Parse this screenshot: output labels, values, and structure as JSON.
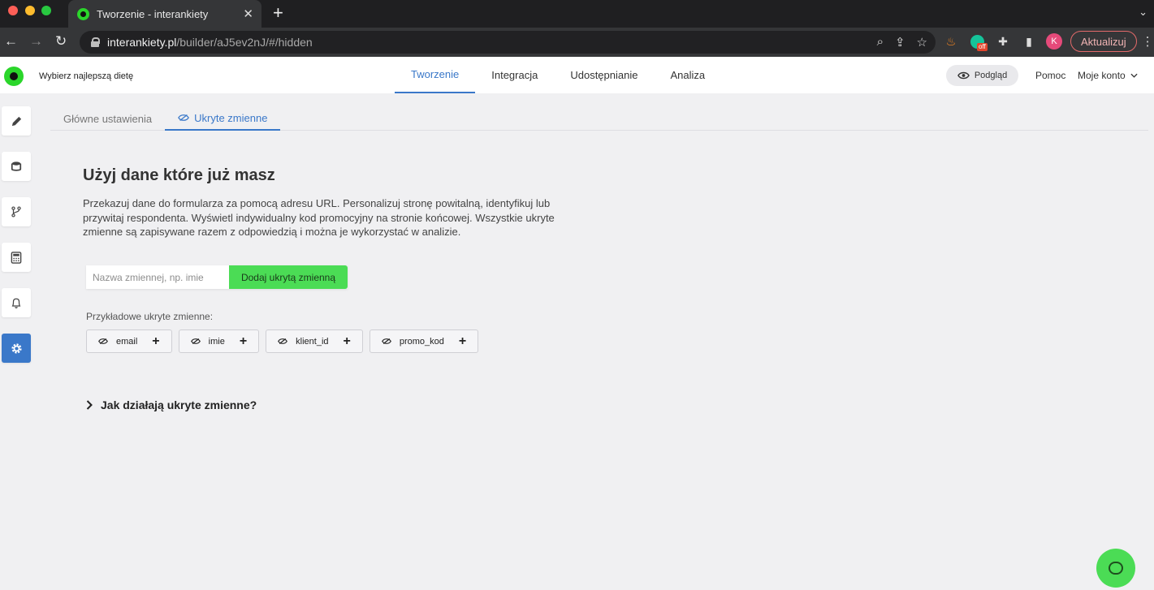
{
  "browser": {
    "tab_title": "Tworzenie - interankiety",
    "url_host": "interankiety.pl",
    "url_path": "/builder/aJ5ev2nJ/#/hidden",
    "extension_badge": "off",
    "avatar_letter": "K",
    "update_label": "Aktualizuj"
  },
  "header": {
    "survey_name": "Wybierz najlepszą dietę",
    "nav": [
      {
        "label": "Tworzenie",
        "active": true
      },
      {
        "label": "Integracja"
      },
      {
        "label": "Udostępnianie"
      },
      {
        "label": "Analiza"
      }
    ],
    "preview_label": "Podgląd",
    "help_label": "Pomoc",
    "account_label": "Moje konto"
  },
  "sidebar": {
    "items": [
      {
        "icon": "pencil-icon"
      },
      {
        "icon": "database-icon"
      },
      {
        "icon": "branch-icon"
      },
      {
        "icon": "calculator-icon"
      },
      {
        "icon": "bell-icon"
      },
      {
        "icon": "gear-icon",
        "active": true
      }
    ]
  },
  "tabs": [
    {
      "label": "Główne ustawienia"
    },
    {
      "label": "Ukryte zmienne",
      "active": true
    }
  ],
  "main": {
    "heading": "Użyj dane które już masz",
    "description": "Przekazuj dane do formularza za pomocą adresu URL. Personalizuj stronę powitalną, identyfikuj lub przywitaj respondenta. Wyświetl indywidualny kod promocyjny na stronie końcowej. Wszystkie ukryte zmienne są zapisywane razem z odpowiedzią i można je wykorzystać w analizie.",
    "input_placeholder": "Nazwa zmiennej, np. imie",
    "input_value": "",
    "add_button_label": "Dodaj ukrytą zmienną",
    "examples_label": "Przykładowe ukryte zmienne:",
    "examples": [
      {
        "label": "email"
      },
      {
        "label": "imie"
      },
      {
        "label": "klient_id"
      },
      {
        "label": "promo_kod"
      }
    ],
    "faq_label": "Jak działają ukryte zmienne?"
  },
  "colors": {
    "accent": "#3a78c9",
    "brand_green": "#4bdc55"
  }
}
